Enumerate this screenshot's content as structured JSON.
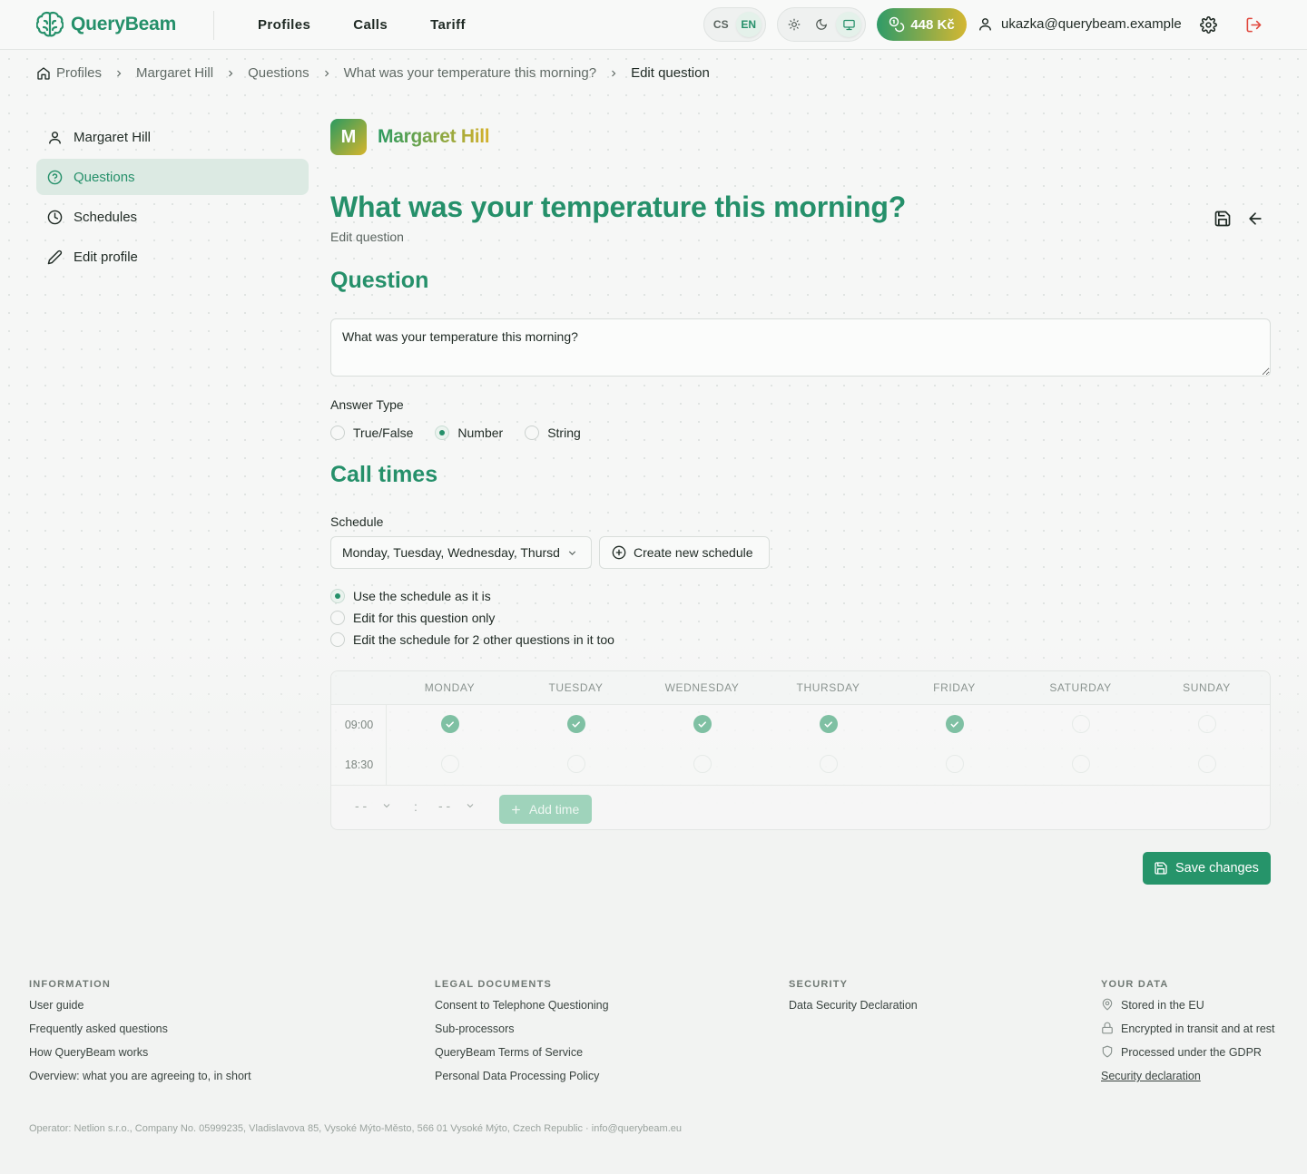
{
  "app": {
    "name": "QueryBeam"
  },
  "header": {
    "nav": [
      "Profiles",
      "Calls",
      "Tariff"
    ],
    "languages": [
      "CS",
      "EN"
    ],
    "active_language": "EN",
    "credit": "448 Kč",
    "user_email": "ukazka@querybeam.example"
  },
  "breadcrumb": {
    "items": [
      "Profiles",
      "Margaret Hill",
      "Questions",
      "What was your temperature this morning?"
    ],
    "current": "Edit question"
  },
  "sidebar": {
    "items": [
      {
        "label": "Margaret Hill",
        "icon": "user-icon"
      },
      {
        "label": "Questions",
        "icon": "question-circle-icon",
        "active": true
      },
      {
        "label": "Schedules",
        "icon": "clock-icon"
      },
      {
        "label": "Edit profile",
        "icon": "pencil-icon"
      }
    ]
  },
  "profile": {
    "initial": "M",
    "name": "Margaret Hill"
  },
  "page": {
    "title": "What was your temperature this morning?",
    "subtitle": "Edit question"
  },
  "question": {
    "section_title": "Question",
    "text": "What was your temperature this morning?",
    "answer_type_label": "Answer Type",
    "answer_types": [
      "True/False",
      "Number",
      "String"
    ],
    "selected_answer_type": "Number"
  },
  "call_times": {
    "section_title": "Call times",
    "schedule_label": "Schedule",
    "schedule_value": "Monday, Tuesday, Wednesday, Thursday, Friday",
    "create_button": "Create new schedule",
    "options": [
      "Use the schedule as it is",
      "Edit for this question only",
      "Edit the schedule for 2 other questions in it too"
    ],
    "selected_option": 0,
    "days": [
      "MONDAY",
      "TUESDAY",
      "WEDNESDAY",
      "THURSDAY",
      "FRIDAY",
      "SATURDAY",
      "SUNDAY"
    ],
    "times": [
      {
        "time": "09:00",
        "enabled": [
          true,
          true,
          true,
          true,
          true,
          false,
          false
        ]
      },
      {
        "time": "18:30",
        "enabled": [
          false,
          false,
          false,
          false,
          false,
          false,
          false
        ]
      }
    ],
    "hour_placeholder": "- -",
    "minute_placeholder": "- -",
    "add_time_button": "Add time"
  },
  "save_button": "Save changes",
  "footer": {
    "information": {
      "title": "INFORMATION",
      "links": [
        "User guide",
        "Frequently asked questions",
        "How QueryBeam works",
        "Overview: what you are agreeing to, in short"
      ]
    },
    "legal": {
      "title": "LEGAL DOCUMENTS",
      "links": [
        "Consent to Telephone Questioning",
        "Sub-processors",
        "QueryBeam Terms of Service",
        "Personal Data Processing Policy"
      ]
    },
    "security": {
      "title": "SECURITY",
      "links": [
        "Data Security Declaration"
      ]
    },
    "your_data": {
      "title": "YOUR DATA",
      "items": [
        "Stored in the EU",
        "Encrypted in transit and at rest",
        "Processed under the GDPR"
      ],
      "link": "Security declaration"
    },
    "operator": "Operator: Netlion s.r.o., Company No. 05999235, Vladislavova 85, Vysoké Mýto-Město, 566 01 Vysoké Mýto, Czech Republic · info@querybeam.eu"
  },
  "colors": {
    "brand": "#25906a",
    "accent": "#d4b732",
    "danger": "#e0463b"
  }
}
